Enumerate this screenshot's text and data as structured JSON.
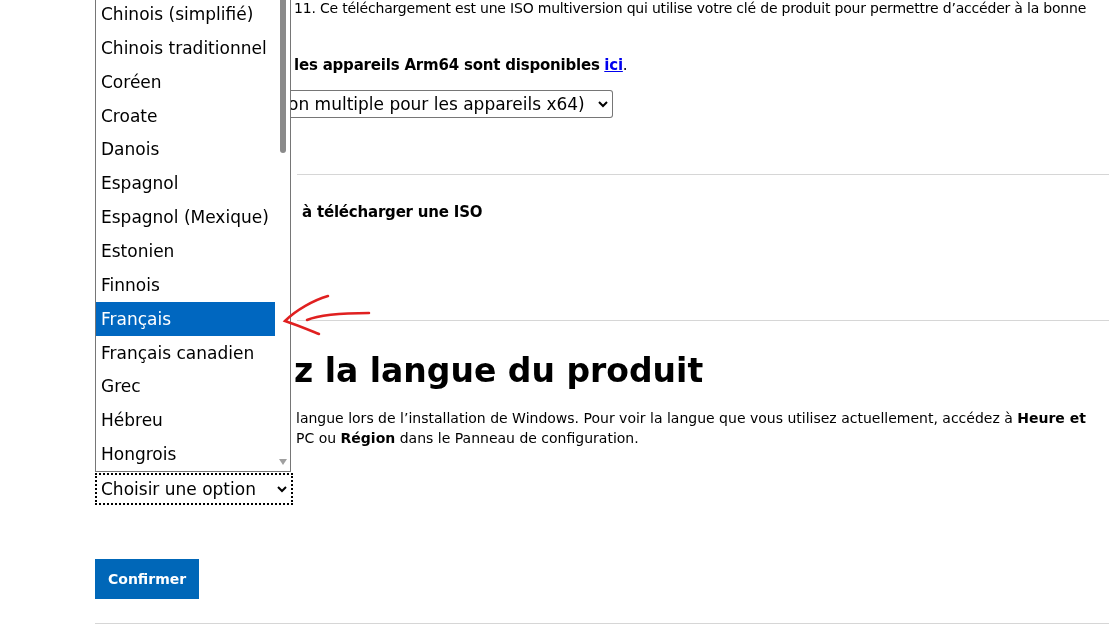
{
  "intro": {
    "text": "11. Ce téléchargement est une ISO multiversion qui utilise votre clé de produit pour permettre d’accéder à la bonne",
    "arm_note": "les appareils Arm64 sont disponibles",
    "arm_link": "ici",
    "arm_end": "."
  },
  "edition_select": {
    "value": "on multiple pour les appareils x64)"
  },
  "download_note": "à télécharger une ISO",
  "language_section": {
    "heading": "z la langue du produit",
    "lines": [
      "langue lors de l’installation de Windows. Pour voir la langue que vous utilisez actuellement, accédez à **Heure et**",
      "PC ou **Région** dans le Panneau de configuration."
    ]
  },
  "language_select": {
    "value": "Choisir une option",
    "expanded": true,
    "options": [
      {
        "label": "Chinois (simplifié)",
        "selected": false
      },
      {
        "label": "Chinois traditionnel",
        "selected": false
      },
      {
        "label": "Coréen",
        "selected": false
      },
      {
        "label": "Croate",
        "selected": false
      },
      {
        "label": "Danois",
        "selected": false
      },
      {
        "label": "Espagnol",
        "selected": false
      },
      {
        "label": "Espagnol (Mexique)",
        "selected": false
      },
      {
        "label": "Estonien",
        "selected": false
      },
      {
        "label": "Finnois",
        "selected": false
      },
      {
        "label": "Français",
        "selected": true
      },
      {
        "label": "Français canadien",
        "selected": false
      },
      {
        "label": "Grec",
        "selected": false
      },
      {
        "label": "Hébreu",
        "selected": false
      },
      {
        "label": "Hongrois",
        "selected": false
      }
    ]
  },
  "confirm_button": "Confirmer"
}
